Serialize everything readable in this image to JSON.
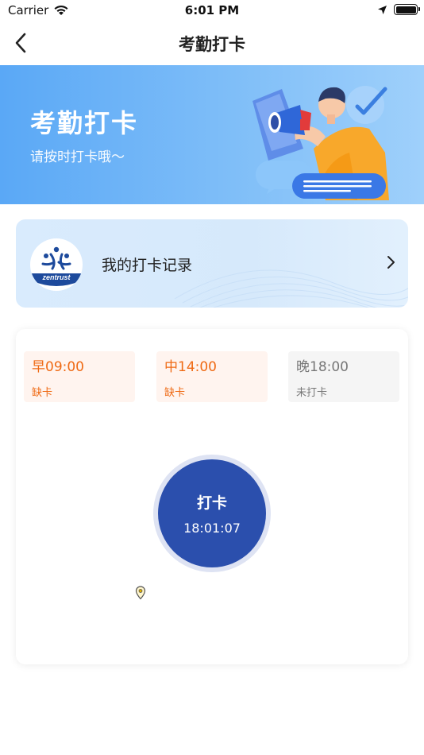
{
  "status_bar": {
    "carrier": "Carrier",
    "time": "6:01 PM"
  },
  "nav": {
    "title": "考勤打卡",
    "back_icon": "chevron-left-icon"
  },
  "banner": {
    "title": "考勤打卡",
    "subtitle": "请按时打卡哦～"
  },
  "record": {
    "label": "我的打卡记录",
    "logo_text": "zentrust",
    "chevron_icon": "chevron-right-icon"
  },
  "slots": [
    {
      "time": "早09:00",
      "status": "缺卡",
      "state": "missing"
    },
    {
      "time": "中14:00",
      "status": "缺卡",
      "state": "missing"
    },
    {
      "time": "晚18:00",
      "status": "未打卡",
      "state": "pending"
    }
  ],
  "punch": {
    "label": "打卡",
    "time": "18:01:07"
  },
  "colors": {
    "accent": "#2b4fad",
    "missing": "#ef6a14",
    "banner": "#5aa8f6"
  }
}
